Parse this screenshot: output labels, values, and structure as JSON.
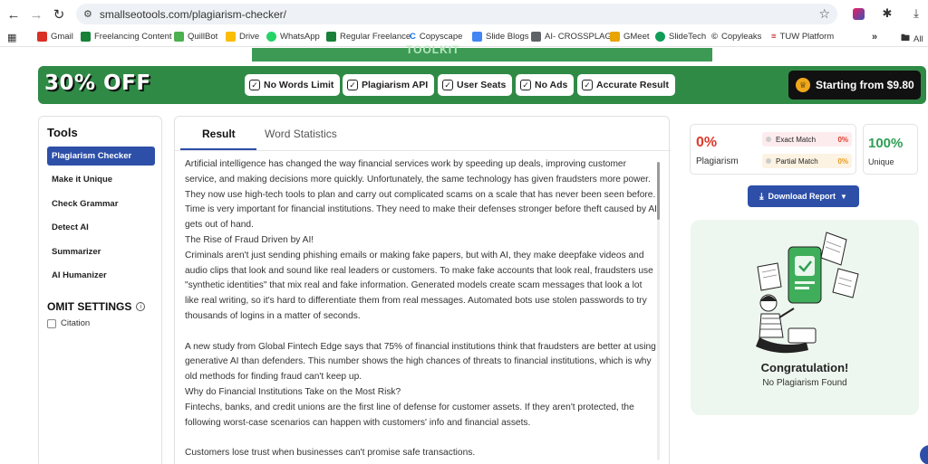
{
  "browser": {
    "url": "smallseotools.com/plagiarism-checker/",
    "bookmarks": [
      {
        "label": "Gmail",
        "color": "#d93025"
      },
      {
        "label": "Freelancing Content",
        "color": "#188038"
      },
      {
        "label": "QuillBot",
        "color": "#4caf50"
      },
      {
        "label": "Drive",
        "color": "#fbbc04"
      },
      {
        "label": "WhatsApp",
        "color": "#25d366"
      },
      {
        "label": "Regular Freelance",
        "color": "#188038"
      },
      {
        "label": "Copyscape",
        "color": "#1a73e8"
      },
      {
        "label": "Slide Blogs",
        "color": "#4285f4"
      },
      {
        "label": "AI- CROSSPLAG",
        "color": "#5f6368"
      },
      {
        "label": "GMeet",
        "color": "#e8a400"
      },
      {
        "label": "SlideTech",
        "color": "#0f9d58"
      },
      {
        "label": "Copyleaks",
        "color": "#444444"
      },
      {
        "label": "TUW Platform",
        "color": "#c62828"
      },
      {
        "label": "All",
        "color": "#555555"
      }
    ]
  },
  "ad_strip": {
    "text": "TOOLKIT"
  },
  "promo": {
    "title": "30% OFF",
    "features": [
      "No Words Limit",
      "Plagiarism API",
      "User Seats",
      "No Ads",
      "Accurate Result"
    ],
    "price_label": "Starting from $9.80"
  },
  "sidebar": {
    "title": "Tools",
    "items": [
      "Plagiarism Checker",
      "Make it Unique",
      "Check Grammar",
      "Detect AI",
      "Summarizer",
      "AI Humanizer"
    ],
    "active_index": 0,
    "omit_title": "OMIT SETTINGS",
    "citation_label": "Citation"
  },
  "tabs": [
    "Result",
    "Word Statistics"
  ],
  "content": {
    "paragraphs": [
      "Artificial intelligence has changed the way financial services work by speeding up deals, improving customer service, and making decisions more quickly. Unfortunately, the same technology has given fraudsters more power. They now use high-tech tools to plan and carry out complicated scams on a scale that has never been seen before. Time is very important for financial institutions. They need to make their defenses stronger before theft caused by AI gets out of hand.",
      "The Rise of Fraud Driven by AI!",
      "Criminals aren't just sending phishing emails or making fake papers, but with AI, they make deepfake videos and audio clips that look and sound like real leaders or customers. To make fake accounts that look real, fraudsters use \"synthetic identities\" that mix real and fake information. Generated models create scam messages that look a lot like real writing, so it's hard to differentiate them from real messages. Automated bots use stolen passwords to try thousands of logins in a matter of seconds.",
      "",
      "A new study from Global Fintech Edge says that 75% of financial institutions think that fraudsters are better at using generative AI than defenders. This number shows the high chances of threats to financial institutions, which is why old methods for finding fraud can't keep up.",
      "Why do Financial Institutions Take on the Most Risk?",
      "Fintechs, banks, and credit unions are the first line of defense for customer assets. If they aren't protected, the following worst-case scenarios can happen with customers' info and financial assets.",
      "",
      "Customers lose trust when businesses can't promise safe transactions."
    ]
  },
  "stats": {
    "plagiarism_pct": "0%",
    "plagiarism_label": "Plagiarism",
    "exact_label": "Exact Match",
    "exact_value": "0%",
    "partial_label": "Partial Match",
    "partial_value": "0%",
    "unique_pct": "100%",
    "unique_label": "Unique"
  },
  "download_label": "Download Report",
  "result_message": {
    "title": "Congratulation!",
    "subtitle": "No Plagiarism Found"
  },
  "colors": {
    "accent": "#2d4fa8",
    "promo_green": "#2f8a46",
    "plagiarism_red": "#e03b2b",
    "unique_green": "#2f9e54"
  }
}
